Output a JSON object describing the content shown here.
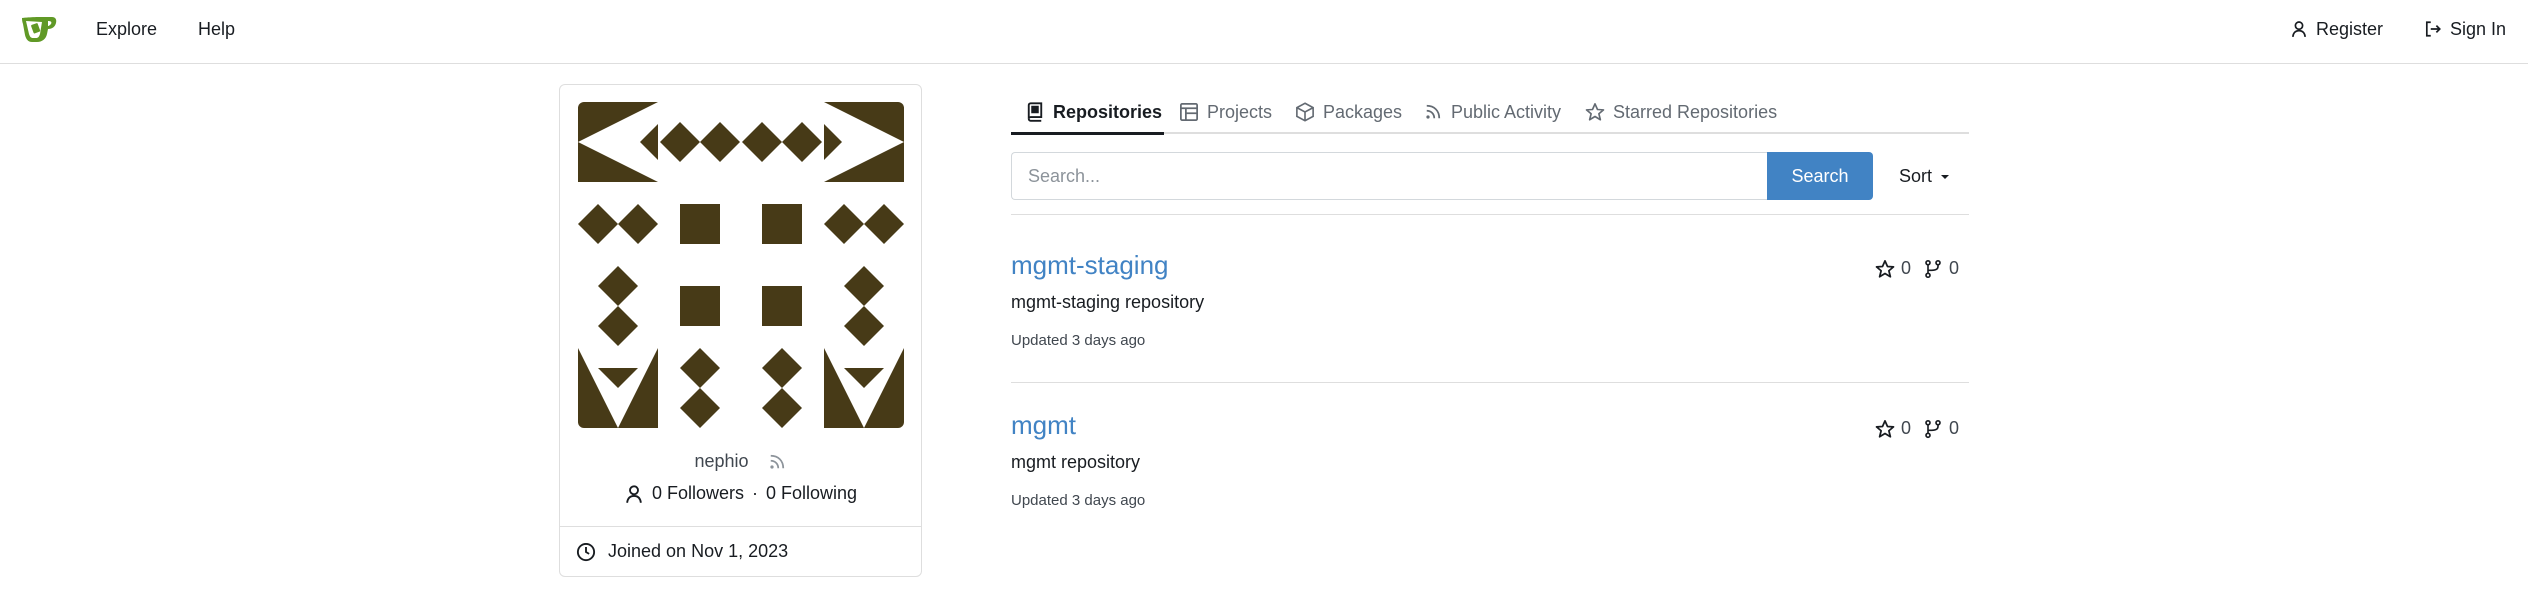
{
  "nav": {
    "explore": "Explore",
    "help": "Help",
    "register": "Register",
    "sign_in": "Sign In",
    "brand_color": "#609926"
  },
  "profile": {
    "username": "nephio",
    "followers": "0 Followers",
    "separator": "·",
    "following": "0 Following",
    "joined": "Joined on Nov 1, 2023",
    "avatar_color": "#473a17"
  },
  "tabs": [
    {
      "label": "Repositories",
      "icon": "repo-icon",
      "active": true
    },
    {
      "label": "Projects",
      "icon": "project-icon",
      "active": false
    },
    {
      "label": "Packages",
      "icon": "package-icon",
      "active": false
    },
    {
      "label": "Public Activity",
      "icon": "rss-icon",
      "active": false
    },
    {
      "label": "Starred Repositories",
      "icon": "star-icon",
      "active": false
    }
  ],
  "search": {
    "placeholder": "Search...",
    "button": "Search",
    "sort": "Sort",
    "accent": "#4183c4"
  },
  "repos": [
    {
      "name": "mgmt-staging",
      "description": "mgmt-staging repository",
      "updated": "Updated 3 days ago",
      "stars": "0",
      "forks": "0"
    },
    {
      "name": "mgmt",
      "description": "mgmt repository",
      "updated": "Updated 3 days ago",
      "stars": "0",
      "forks": "0"
    }
  ]
}
